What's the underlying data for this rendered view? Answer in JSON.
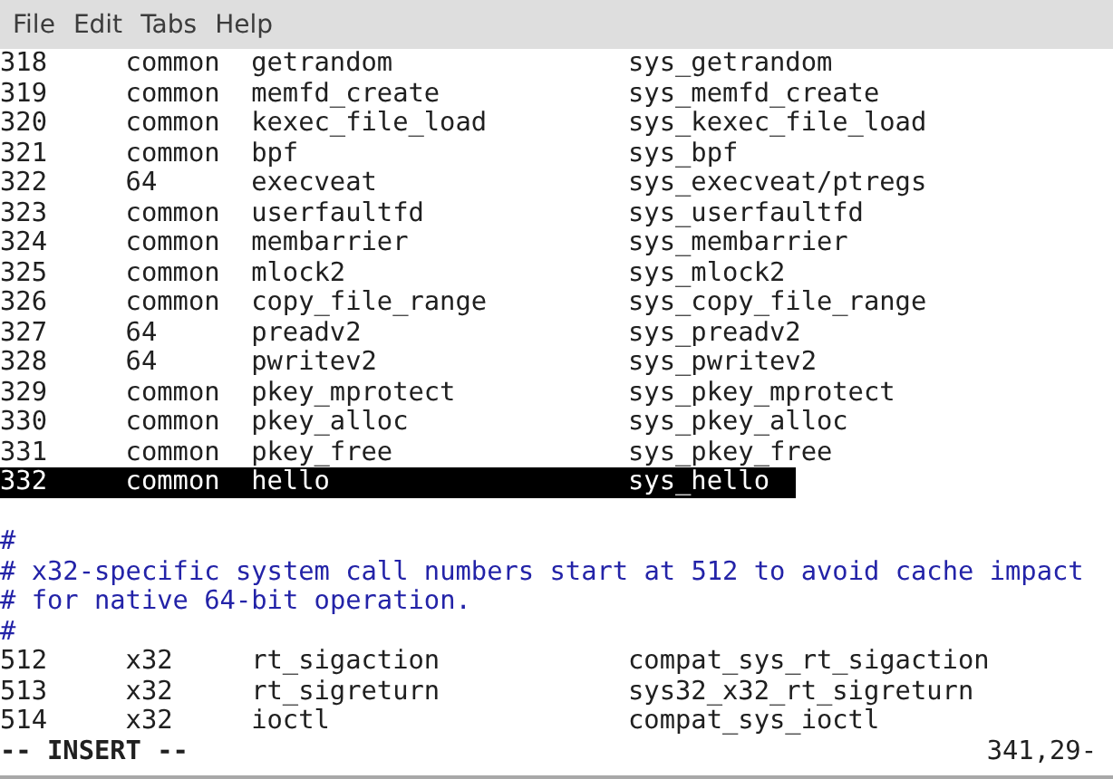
{
  "menu": [
    "File",
    "Edit",
    "Tabs",
    "Help"
  ],
  "editor": {
    "lines": [
      {
        "kind": "syscall",
        "number": "318",
        "abi": "common",
        "name": "getrandom",
        "entry": "sys_getrandom",
        "selected": false
      },
      {
        "kind": "syscall",
        "number": "319",
        "abi": "common",
        "name": "memfd_create",
        "entry": "sys_memfd_create",
        "selected": false
      },
      {
        "kind": "syscall",
        "number": "320",
        "abi": "common",
        "name": "kexec_file_load",
        "entry": "sys_kexec_file_load",
        "selected": false
      },
      {
        "kind": "syscall",
        "number": "321",
        "abi": "common",
        "name": "bpf",
        "entry": "sys_bpf",
        "selected": false
      },
      {
        "kind": "syscall",
        "number": "322",
        "abi": "64",
        "name": "execveat",
        "entry": "sys_execveat/ptregs",
        "selected": false
      },
      {
        "kind": "syscall",
        "number": "323",
        "abi": "common",
        "name": "userfaultfd",
        "entry": "sys_userfaultfd",
        "selected": false
      },
      {
        "kind": "syscall",
        "number": "324",
        "abi": "common",
        "name": "membarrier",
        "entry": "sys_membarrier",
        "selected": false
      },
      {
        "kind": "syscall",
        "number": "325",
        "abi": "common",
        "name": "mlock2",
        "entry": "sys_mlock2",
        "selected": false
      },
      {
        "kind": "syscall",
        "number": "326",
        "abi": "common",
        "name": "copy_file_range",
        "entry": "sys_copy_file_range",
        "selected": false
      },
      {
        "kind": "syscall",
        "number": "327",
        "abi": "64",
        "name": "preadv2",
        "entry": "sys_preadv2",
        "selected": false
      },
      {
        "kind": "syscall",
        "number": "328",
        "abi": "64",
        "name": "pwritev2",
        "entry": "sys_pwritev2",
        "selected": false
      },
      {
        "kind": "syscall",
        "number": "329",
        "abi": "common",
        "name": "pkey_mprotect",
        "entry": "sys_pkey_mprotect",
        "selected": false
      },
      {
        "kind": "syscall",
        "number": "330",
        "abi": "common",
        "name": "pkey_alloc",
        "entry": "sys_pkey_alloc",
        "selected": false
      },
      {
        "kind": "syscall",
        "number": "331",
        "abi": "common",
        "name": "pkey_free",
        "entry": "sys_pkey_free",
        "selected": false
      },
      {
        "kind": "syscall",
        "number": "332",
        "abi": "common",
        "name": "hello",
        "entry": "sys_hello",
        "selected": true
      },
      {
        "kind": "blank"
      },
      {
        "kind": "comment",
        "text": "#"
      },
      {
        "kind": "comment",
        "text": "# x32-specific system call numbers start at 512 to avoid cache impact"
      },
      {
        "kind": "comment",
        "text": "# for native 64-bit operation."
      },
      {
        "kind": "comment",
        "text": "#"
      },
      {
        "kind": "syscall",
        "number": "512",
        "abi": "x32",
        "name": "rt_sigaction",
        "entry": "compat_sys_rt_sigaction",
        "selected": false
      },
      {
        "kind": "syscall",
        "number": "513",
        "abi": "x32",
        "name": "rt_sigreturn",
        "entry": "sys32_x32_rt_sigreturn",
        "selected": false
      },
      {
        "kind": "syscall",
        "number": "514",
        "abi": "x32",
        "name": "ioctl",
        "entry": "compat_sys_ioctl",
        "selected": false
      }
    ]
  },
  "status": {
    "mode": "-- INSERT --",
    "position": "341,29-"
  }
}
